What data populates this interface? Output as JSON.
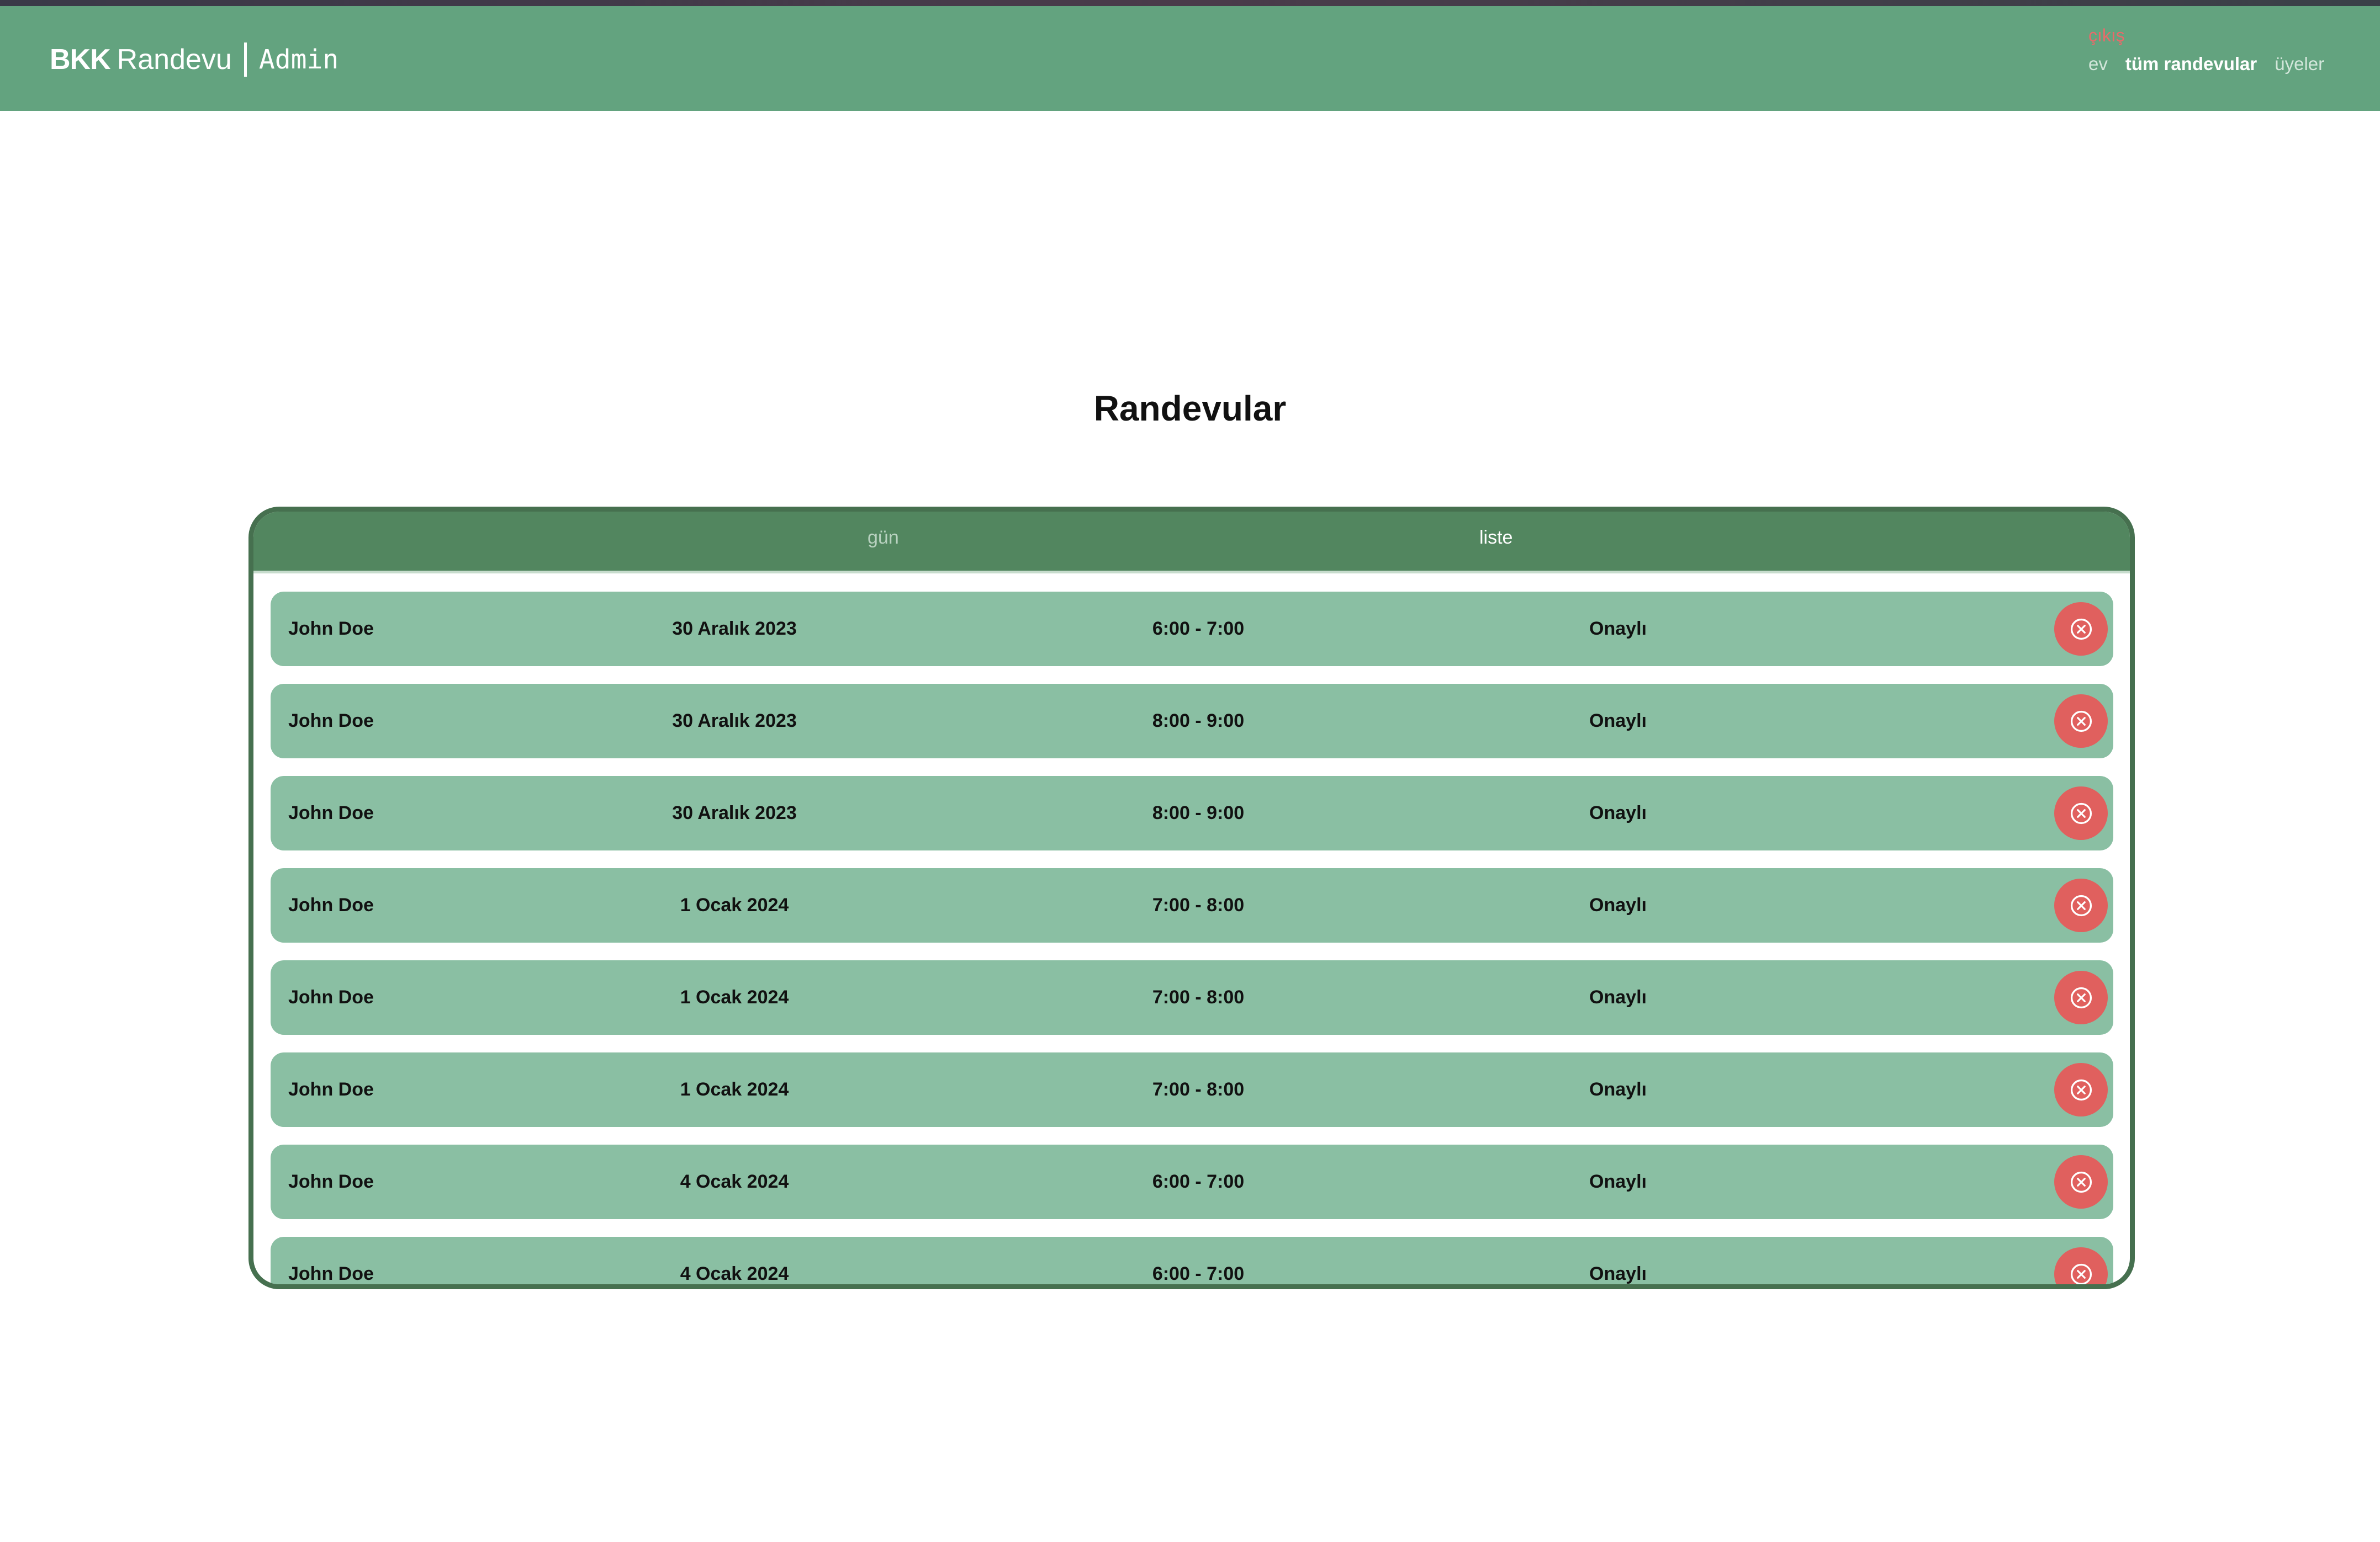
{
  "header": {
    "brand_bold": "BKK",
    "brand_light": "Randevu",
    "brand_admin": "Admin",
    "logout_label": "çıkış",
    "nav": [
      "ev",
      "tüm randevular",
      "üyeler"
    ],
    "active_nav": "tüm randevular"
  },
  "page": {
    "title": "Randevular"
  },
  "tabs": {
    "day_label": "gün",
    "list_label": "liste",
    "active": "liste"
  },
  "appointments": [
    {
      "name": "John Doe",
      "date": "30 Aralık 2023",
      "time": "6:00 - 7:00",
      "status": "Onaylı"
    },
    {
      "name": "John Doe",
      "date": "30 Aralık 2023",
      "time": "8:00 - 9:00",
      "status": "Onaylı"
    },
    {
      "name": "John Doe",
      "date": "30 Aralık 2023",
      "time": "8:00 - 9:00",
      "status": "Onaylı"
    },
    {
      "name": "John Doe",
      "date": "1 Ocak 2024",
      "time": "7:00 - 8:00",
      "status": "Onaylı"
    },
    {
      "name": "John Doe",
      "date": "1 Ocak 2024",
      "time": "7:00 - 8:00",
      "status": "Onaylı"
    },
    {
      "name": "John Doe",
      "date": "1 Ocak 2024",
      "time": "7:00 - 8:00",
      "status": "Onaylı"
    },
    {
      "name": "John Doe",
      "date": "4 Ocak 2024",
      "time": "6:00 - 7:00",
      "status": "Onaylı"
    },
    {
      "name": "John Doe",
      "date": "4 Ocak 2024",
      "time": "6:00 - 7:00",
      "status": "Onaylı"
    }
  ],
  "icons": {
    "cancel": "circle-x-icon"
  },
  "colors": {
    "navbar": "#63a37f",
    "panel_border": "#46704f",
    "tab_bar": "#52865f",
    "row": "#8abfa3",
    "cancel": "#e0605e",
    "logout": "#e86a6a"
  }
}
